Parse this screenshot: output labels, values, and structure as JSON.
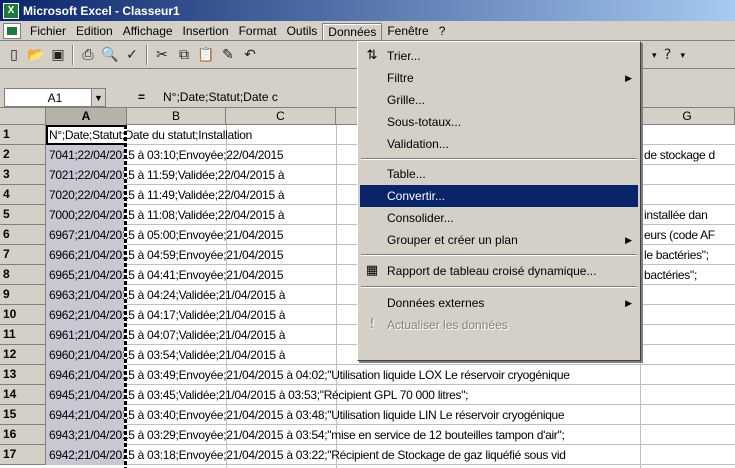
{
  "window": {
    "title": "Microsoft Excel - Classeur1",
    "app_icon": "excel-icon"
  },
  "menubar": {
    "items": [
      "Fichier",
      "Edition",
      "Affichage",
      "Insertion",
      "Format",
      "Outils",
      "Données",
      "Fenêtre",
      "?"
    ],
    "active": "Données"
  },
  "formula_bar": {
    "name_box": "A1",
    "equals": "=",
    "content": "N°;Date;Statut;Date c"
  },
  "columns": [
    "A",
    "B",
    "C",
    "G"
  ],
  "rows": [
    {
      "n": "1",
      "text": "N°;Date;Statut;Date du statut;Installation"
    },
    {
      "n": "2",
      "text": "7041;22/04/2015 à 03:10;Envoyée;22/04/2015"
    },
    {
      "n": "3",
      "text": "7021;22/04/2015 à 11:59;Validée;22/04/2015 à"
    },
    {
      "n": "4",
      "text": "7020;22/04/2015 à 11:49;Validée;22/04/2015 à"
    },
    {
      "n": "5",
      "text": "7000;22/04/2015 à 11:08;Validée;22/04/2015 à"
    },
    {
      "n": "6",
      "text": "6967;21/04/2015 à 05:00;Envoyée;21/04/2015"
    },
    {
      "n": "7",
      "text": "6966;21/04/2015 à 04:59;Envoyée;21/04/2015"
    },
    {
      "n": "8",
      "text": "6965;21/04/2015 à 04:41;Envoyée;21/04/2015"
    },
    {
      "n": "9",
      "text": "6963;21/04/2015 à 04:24;Validée;21/04/2015 à"
    },
    {
      "n": "10",
      "text": "6962;21/04/2015 à 04:17;Validée;21/04/2015 à"
    },
    {
      "n": "11",
      "text": "6961;21/04/2015 à 04:07;Validée;21/04/2015 à"
    },
    {
      "n": "12",
      "text": "6960;21/04/2015 à 03:54;Validée;21/04/2015 à"
    },
    {
      "n": "13",
      "text": "6946;21/04/2015 à 03:49;Envoyée;21/04/2015 à 04:02;\"Utilisation liquide LOX Le réservoir cryogénique"
    },
    {
      "n": "14",
      "text": "6945;21/04/2015 à 03:45;Validée;21/04/2015 à 03:53;\"Récipient GPL 70 000 litres\";"
    },
    {
      "n": "15",
      "text": "6944;21/04/2015 à 03:40;Envoyée;21/04/2015 à 03:48;\"Utilisation liquide LIN Le réservoir cryogénique"
    },
    {
      "n": "16",
      "text": "6943;21/04/2015 à 03:29;Envoyée;21/04/2015 à 03:54;\"mise en service de 12 bouteilles tampon d'air\";"
    },
    {
      "n": "17",
      "text": "6942;21/04/2015 à 03:18;Envoyée;21/04/2015 à 03:22;\"Récipient de Stockage de gaz liquéfié sous vid"
    }
  ],
  "right_fragments": [
    {
      "row": 2,
      "text": "de stockage d"
    },
    {
      "row": 5,
      "text": "installée dan"
    },
    {
      "row": 6,
      "text": "eurs (code AF"
    },
    {
      "row": 7,
      "text": "le bactéries\";"
    },
    {
      "row": 8,
      "text": "bactéries\";"
    }
  ],
  "data_menu": {
    "items": [
      {
        "label": "Trier...",
        "icon": "sort-az-icon",
        "submenu": false,
        "disabled": false
      },
      {
        "label": "Filtre",
        "icon": "",
        "submenu": true,
        "disabled": false
      },
      {
        "label": "Grille...",
        "icon": "",
        "submenu": false,
        "disabled": false
      },
      {
        "label": "Sous-totaux...",
        "icon": "",
        "submenu": false,
        "disabled": false
      },
      {
        "label": "Validation...",
        "icon": "",
        "submenu": false,
        "disabled": false
      },
      {
        "label": "Table...",
        "icon": "",
        "submenu": false,
        "disabled": false
      },
      {
        "label": "Convertir...",
        "icon": "",
        "submenu": false,
        "disabled": false,
        "highlighted": true
      },
      {
        "label": "Consolider...",
        "icon": "",
        "submenu": false,
        "disabled": false
      },
      {
        "label": "Grouper et créer un plan",
        "icon": "",
        "submenu": true,
        "disabled": false
      },
      {
        "label": "Rapport de tableau croisé dynamique...",
        "icon": "pivot-table-icon",
        "submenu": false,
        "disabled": false
      },
      {
        "label": "Données externes",
        "icon": "",
        "submenu": true,
        "disabled": false
      },
      {
        "label": "Actualiser les données",
        "icon": "refresh-icon",
        "submenu": false,
        "disabled": true
      }
    ]
  }
}
